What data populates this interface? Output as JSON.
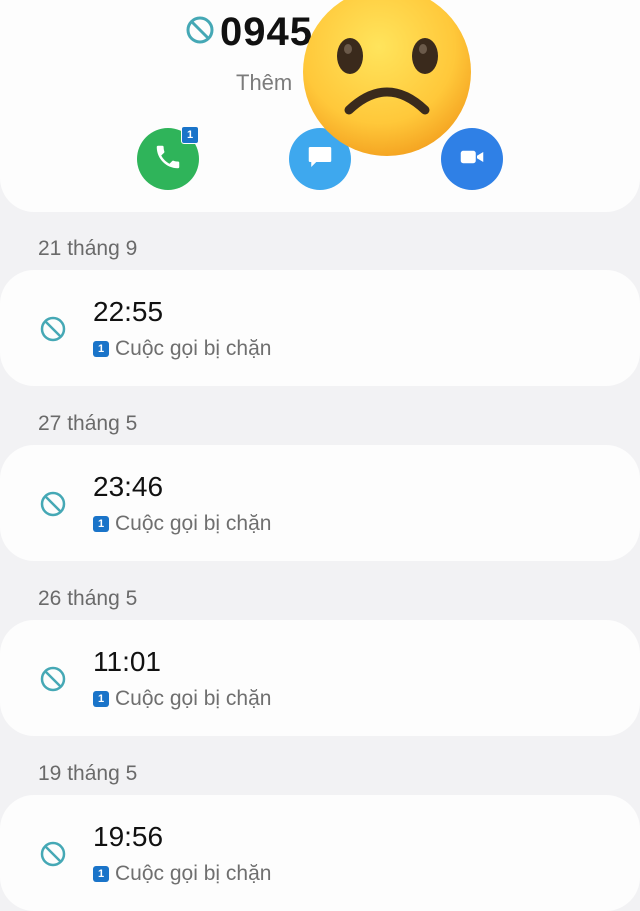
{
  "header": {
    "phone_number": "0945",
    "add_contact_label": "Thêm",
    "call_badge": "1"
  },
  "icons": {
    "blocked": "blocked-icon",
    "call": "phone-icon",
    "message": "message-icon",
    "video": "video-call-icon",
    "overlay": "sad-face-emoji"
  },
  "colors": {
    "call": "#2fb45a",
    "message": "#3ea8ee",
    "video": "#2f80e6",
    "sim_badge": "#1a74c9",
    "blocked_icon": "#45a8b5"
  },
  "log_groups": [
    {
      "date": "21 tháng 9",
      "time": "22:55",
      "sim": "1",
      "status": "Cuộc gọi bị chặn"
    },
    {
      "date": "27 tháng 5",
      "time": "23:46",
      "sim": "1",
      "status": "Cuộc gọi bị chặn"
    },
    {
      "date": "26 tháng 5",
      "time": "11:01",
      "sim": "1",
      "status": "Cuộc gọi bị chặn"
    },
    {
      "date": "19 tháng 5",
      "time": "19:56",
      "sim": "1",
      "status": "Cuộc gọi bị chặn"
    }
  ]
}
